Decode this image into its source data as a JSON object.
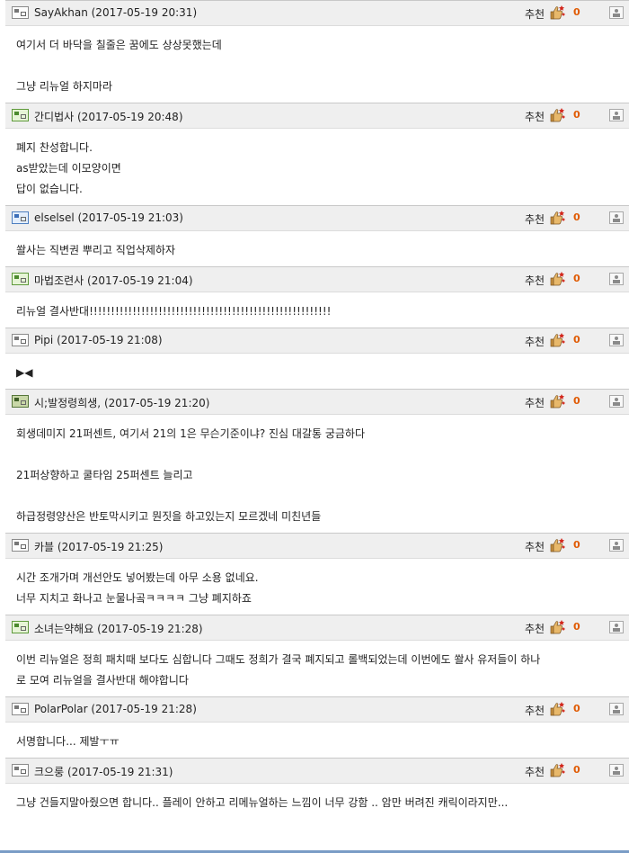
{
  "recommend_label": "추천",
  "comments": [
    {
      "author": "SayAkhan",
      "time": "(2017-05-19 20:31)",
      "likes": "0",
      "badge": "gray",
      "lines": [
        "여기서 더 바닥을 칠줄은 꿈에도 상상못했는데",
        "",
        "그냥 리뉴얼 하지마라"
      ]
    },
    {
      "author": "간디법사",
      "time": "(2017-05-19 20:48)",
      "likes": "0",
      "badge": "green",
      "lines": [
        "폐지 찬성합니다.",
        "as받았는데 이모양이면",
        "답이 없습니다."
      ]
    },
    {
      "author": "elselsel",
      "time": "(2017-05-19 21:03)",
      "likes": "0",
      "badge": "blue",
      "lines": [
        "쏼사는 직변권 뿌리고 직업삭제하자"
      ]
    },
    {
      "author": "마법조련사",
      "time": "(2017-05-19 21:04)",
      "likes": "0",
      "badge": "green",
      "lines": [
        "리뉴얼 결사반대!!!!!!!!!!!!!!!!!!!!!!!!!!!!!!!!!!!!!!!!!!!!!!!!!!!!!!!!"
      ]
    },
    {
      "author": "Pipi",
      "time": "(2017-05-19 21:08)",
      "likes": "0",
      "badge": "gray",
      "lines": [
        "▶◀"
      ]
    },
    {
      "author": "시;발정령희생,",
      "time": "(2017-05-19 21:20)",
      "likes": "0",
      "badge": "map",
      "lines": [
        "회생데미지 21퍼센트, 여기서 21의 1은 무슨기준이냐? 진심 대갈통 궁금하다",
        "",
        "21퍼상향하고 쿨타임 25퍼센트 늘리고",
        "",
        "하급정령양산은 반토막시키고 뭔짓을 하고있는지 모르겠네 미친년들"
      ]
    },
    {
      "author": "카블",
      "time": "(2017-05-19 21:25)",
      "likes": "0",
      "badge": "gray",
      "lines": [
        "시간 조개가며 개선안도 넣어봤는데 아무 소용 없네요.",
        "너무 지치고 화나고 눈물나곸ㅋㅋㅋㅋ 그냥 폐지하죠"
      ]
    },
    {
      "author": "소녀는약해요",
      "time": "(2017-05-19 21:28)",
      "likes": "0",
      "badge": "green",
      "lines": [
        "이번 리뉴얼은 정희 패치때 보다도 심합니다 그때도 정희가 결국 폐지되고 롤백되었는데 이번에도 쏼사 유저들이 하나",
        "로 모여 리뉴얼을 결사반대 해야합니다"
      ]
    },
    {
      "author": "PolarPolar",
      "time": "(2017-05-19 21:28)",
      "likes": "0",
      "badge": "gray",
      "lines": [
        "서명합니다... 제발ㅜㅠ"
      ]
    },
    {
      "author": "크으룽",
      "time": "(2017-05-19 21:31)",
      "likes": "0",
      "badge": "gray",
      "lines": [
        "그냥 건들지말아줬으면 합니다.. 플레이 안하고 리메뉴얼하는 느낌이 너무 강함 .. 암만 버려진 캐릭이라지만..."
      ]
    }
  ]
}
